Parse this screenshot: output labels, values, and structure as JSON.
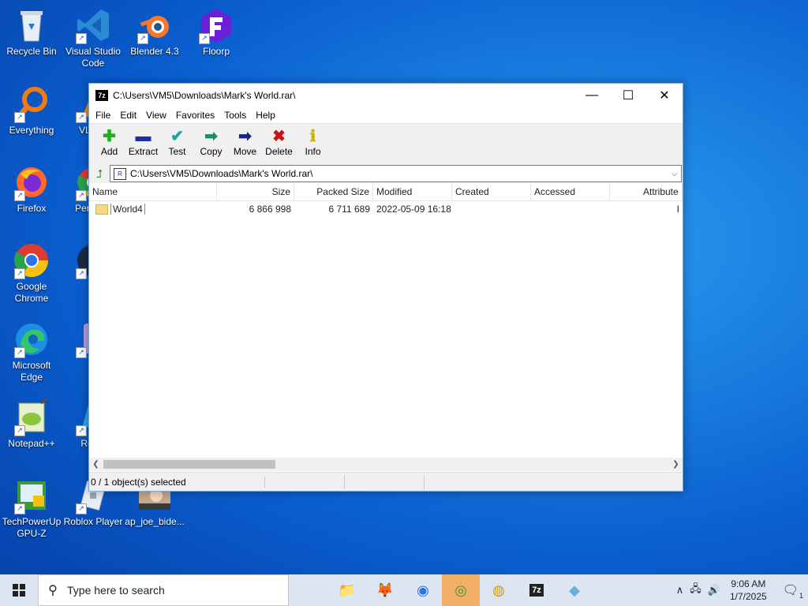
{
  "desktop": {
    "icons": [
      {
        "label": "Recycle Bin"
      },
      {
        "label": "Visual Studio Code"
      },
      {
        "label": "Blender 4.3"
      },
      {
        "label": "Floorp"
      },
      {
        "label": "Everything"
      },
      {
        "label": "VLC pl"
      },
      {
        "label": "Firefox"
      },
      {
        "label": "Pers Chi"
      },
      {
        "label": "Google Chrome"
      },
      {
        "label": "St"
      },
      {
        "label": "Microsoft Edge"
      },
      {
        "label": "M"
      },
      {
        "label": "Notepad++"
      },
      {
        "label": "Roblo"
      },
      {
        "label": "TechPowerUp GPU-Z"
      },
      {
        "label": "Roblox Player"
      },
      {
        "label": "ap_joe_bide..."
      }
    ]
  },
  "window": {
    "title": "C:\\Users\\VM5\\Downloads\\Mark's World.rar\\",
    "app_icon": "7z",
    "controls": {
      "minimize": "—",
      "maximize": "☐",
      "close": "✕"
    },
    "menu": [
      "File",
      "Edit",
      "View",
      "Favorites",
      "Tools",
      "Help"
    ],
    "toolbar": [
      {
        "label": "Add",
        "icon": "plus-icon",
        "glyph": "✚",
        "color": "#1fae1f"
      },
      {
        "label": "Extract",
        "icon": "minus-icon",
        "glyph": "▬",
        "color": "#1a2f9e"
      },
      {
        "label": "Test",
        "icon": "check-icon",
        "glyph": "✔",
        "color": "#1aa69a"
      },
      {
        "label": "Copy",
        "icon": "copy-arrow-icon",
        "glyph": "➡",
        "color": "#1f8a6a"
      },
      {
        "label": "Move",
        "icon": "move-arrow-icon",
        "glyph": "➡",
        "color": "#1a237e"
      },
      {
        "label": "Delete",
        "icon": "delete-x-icon",
        "glyph": "✖",
        "color": "#d01010"
      },
      {
        "label": "Info",
        "icon": "info-icon",
        "glyph": "ℹ",
        "color": "#c9b400"
      }
    ],
    "address": "C:\\Users\\VM5\\Downloads\\Mark's World.rar\\",
    "columns": [
      "Name",
      "Size",
      "Packed Size",
      "Modified",
      "Created",
      "Accessed",
      "Attribute"
    ],
    "rows": [
      {
        "name": "World4",
        "size": "6 866 998",
        "packed": "6 711 689",
        "modified": "2022-05-09 16:18",
        "created": "",
        "accessed": "",
        "attr": "I"
      }
    ],
    "status": "0 / 1 object(s) selected"
  },
  "taskbar": {
    "search_placeholder": "Type here to search",
    "apps": [
      {
        "name": "file-explorer-icon",
        "glyph": "📁"
      },
      {
        "name": "firefox-icon",
        "glyph": "🦊"
      },
      {
        "name": "chrome-icon",
        "glyph": "◉"
      },
      {
        "name": "app-green-icon",
        "glyph": "◎"
      },
      {
        "name": "app-yellow-icon",
        "glyph": "◍"
      },
      {
        "name": "7zip-icon",
        "glyph": "7z"
      },
      {
        "name": "app-blue-icon",
        "glyph": "◆"
      }
    ],
    "time": "9:06 AM",
    "date": "1/7/2025",
    "notification_count": "1"
  }
}
